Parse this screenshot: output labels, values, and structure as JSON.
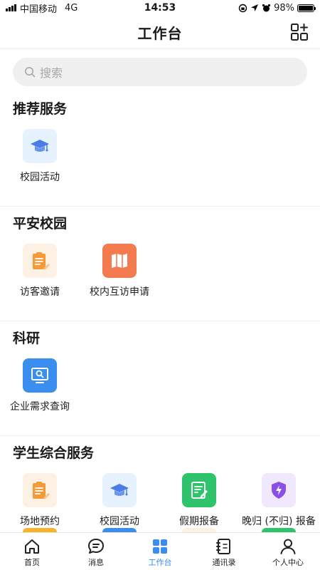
{
  "status_bar": {
    "carrier": "中国移动",
    "network": "4G",
    "time": "14:53",
    "battery": "98%",
    "battery_level": 0.98
  },
  "header": {
    "title": "工作台",
    "action_icon": "grid-add-icon"
  },
  "search": {
    "placeholder": "搜索"
  },
  "sections": [
    {
      "title": "推荐服务",
      "items": [
        {
          "label": "校园活动",
          "icon": "graduation-cap-icon",
          "bg": "#e6f2fd",
          "color": "#4a7de8"
        }
      ]
    },
    {
      "title": "平安校园",
      "items": [
        {
          "label": "访客邀请",
          "icon": "clipboard-edit-icon",
          "bg": "#fdf1e4",
          "color": "#f39a3a"
        },
        {
          "label": "校内互访申请",
          "icon": "map-icon",
          "bg": "#f47b4f",
          "color": "#ffffff"
        }
      ]
    },
    {
      "title": "科研",
      "items": [
        {
          "label": "企业需求查询",
          "icon": "monitor-search-icon",
          "bg": "#3a8ef0",
          "color": "#ffffff"
        }
      ]
    },
    {
      "title": "学生综合服务",
      "items": [
        {
          "label": "场地预约",
          "icon": "clipboard-edit-icon",
          "bg": "#fdf1e4",
          "color": "#f39a3a"
        },
        {
          "label": "校园活动",
          "icon": "graduation-cap-icon",
          "bg": "#e6f2fd",
          "color": "#4a7de8"
        },
        {
          "label": "假期报备",
          "icon": "document-edit-icon",
          "bg": "#2fc46b",
          "color": "#ffffff"
        },
        {
          "label": "晚归 (不归) 报备",
          "icon": "shield-lightning-icon",
          "bg": "#f0e8fd",
          "color": "#8a4fe8"
        }
      ]
    }
  ],
  "peek_colors": [
    "#f7b32b",
    "#3a8ef0",
    "#fdf1e4",
    "#2fc46b"
  ],
  "tabs": [
    {
      "label": "首页",
      "icon": "home-icon",
      "active": false
    },
    {
      "label": "消息",
      "icon": "message-icon",
      "active": false
    },
    {
      "label": "工作台",
      "icon": "workbench-icon",
      "active": true
    },
    {
      "label": "通讯录",
      "icon": "contacts-icon",
      "active": false
    },
    {
      "label": "个人中心",
      "icon": "user-icon",
      "active": false
    }
  ],
  "colors": {
    "accent": "#3a8ef0",
    "divider": "#efefef"
  }
}
